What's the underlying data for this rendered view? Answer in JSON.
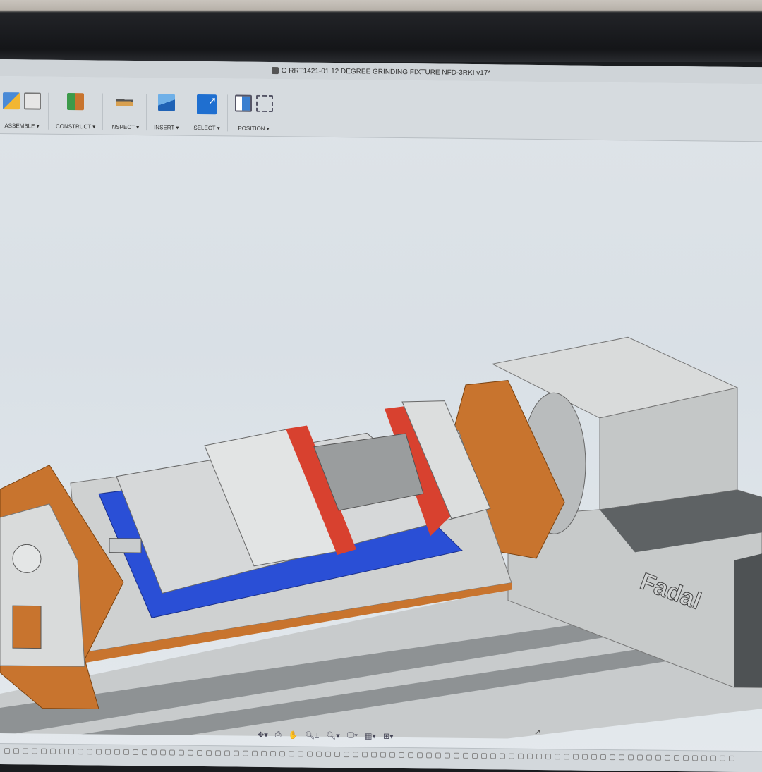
{
  "window": {
    "title": "C-RRT1421-01 12 DEGREE GRINDING FIXTURE NFD-3RKI v17*"
  },
  "toolbar": {
    "groups": [
      {
        "label": "ASSEMBLE ▾",
        "icon": "assemble-icon"
      },
      {
        "label": "CONSTRUCT ▾",
        "icon": "construct-plane-icon"
      },
      {
        "label": "INSPECT ▾",
        "icon": "measure-icon"
      },
      {
        "label": "INSERT ▾",
        "icon": "insert-image-icon"
      },
      {
        "label": "SELECT ▾",
        "icon": "select-cursor-icon"
      },
      {
        "label": "POSITION ▾",
        "icon": "position-icon"
      }
    ]
  },
  "model": {
    "brand_text": "Fadal"
  },
  "navbar": {
    "items": [
      "✥▾",
      "⎙",
      "✋",
      "🔍︎±",
      "🔍︎▾",
      "🖵▾",
      "▦▾",
      "⊞▾"
    ]
  },
  "colors": {
    "orange": "#c8742e",
    "blue": "#2a4fd6",
    "red": "#d8412f",
    "gray": "#c9cccd"
  }
}
